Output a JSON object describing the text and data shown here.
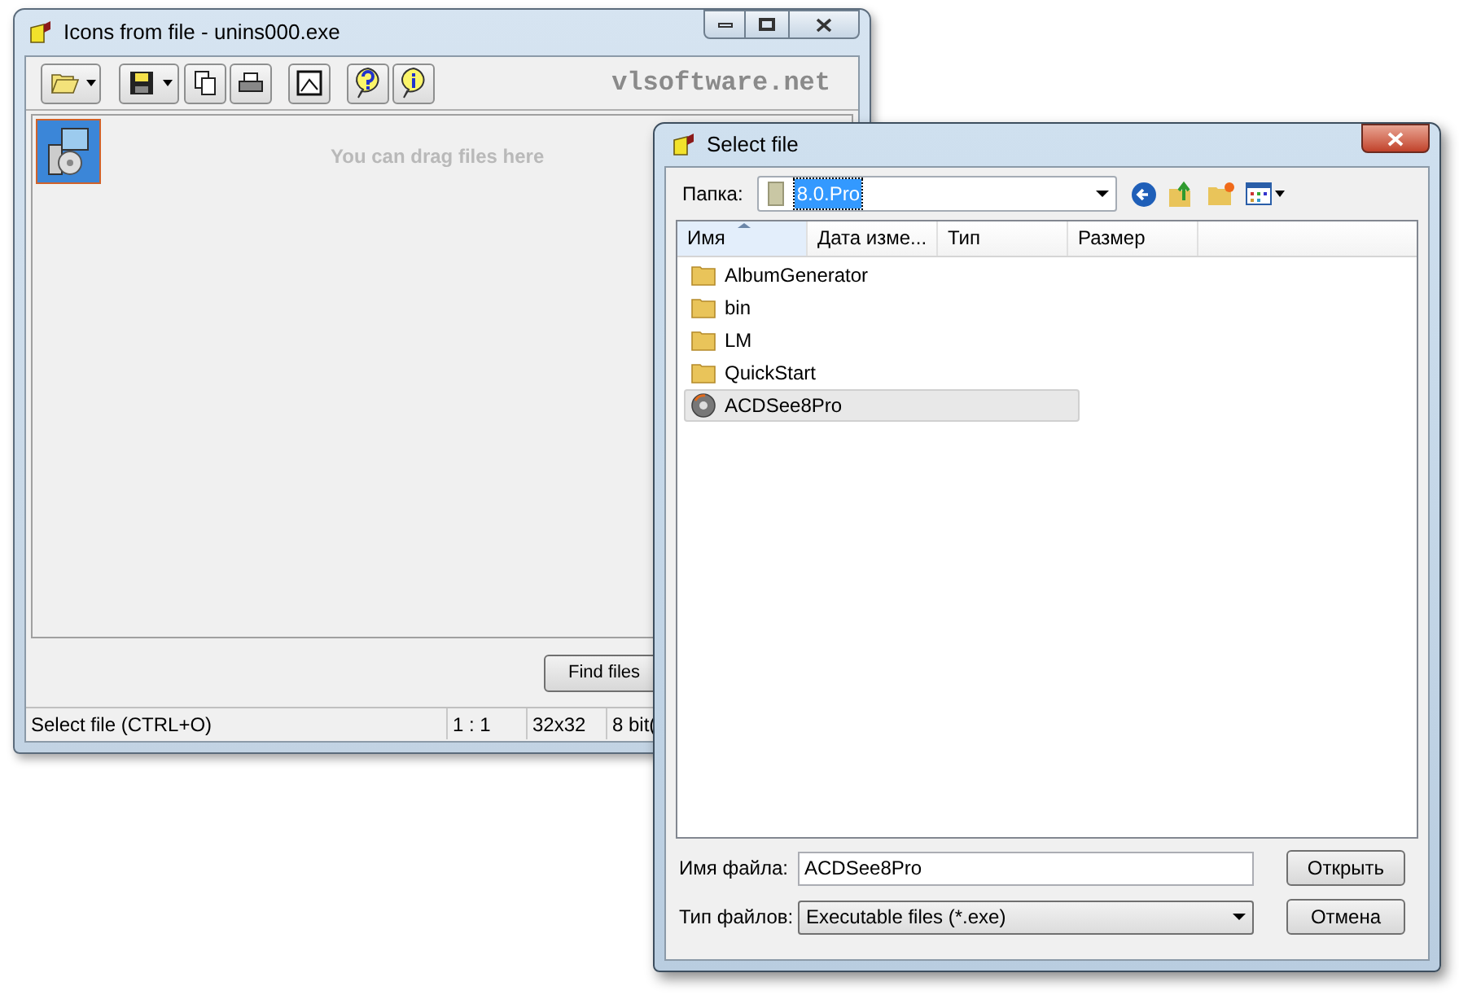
{
  "main_window": {
    "title": "Icons from file - unins000.exe",
    "site": "vlsoftware.net",
    "drop_hint": "You can drag files here",
    "icons": [
      {
        "selected": true
      }
    ],
    "find_button": "Find files",
    "status_bar": [
      "Select file (CTRL+O)",
      "1 : 1",
      "32x32",
      "8 bit("
    ]
  },
  "dialog": {
    "title": "Select file",
    "folder_label": "Папка:",
    "folder_value": "8.0.Pro",
    "columns": [
      {
        "label": "Имя",
        "sorted": true
      },
      {
        "label": "Дата изме...",
        "sorted": false
      },
      {
        "label": "Тип",
        "sorted": false
      },
      {
        "label": "Размер",
        "sorted": false
      }
    ],
    "files": [
      {
        "name": "AlbumGenerator",
        "kind": "folder",
        "selected": false
      },
      {
        "name": "bin",
        "kind": "folder",
        "selected": false
      },
      {
        "name": "LM",
        "kind": "folder",
        "selected": false
      },
      {
        "name": "QuickStart",
        "kind": "folder",
        "selected": false
      },
      {
        "name": "ACDSee8Pro",
        "kind": "app",
        "selected": true
      }
    ],
    "filename_label": "Имя файла:",
    "filename_value": "ACDSee8Pro",
    "filetype_label": "Тип файлов:",
    "filetype_value": "Executable files (*.exe)",
    "buttons": [
      "Открыть",
      "Отмена"
    ]
  }
}
